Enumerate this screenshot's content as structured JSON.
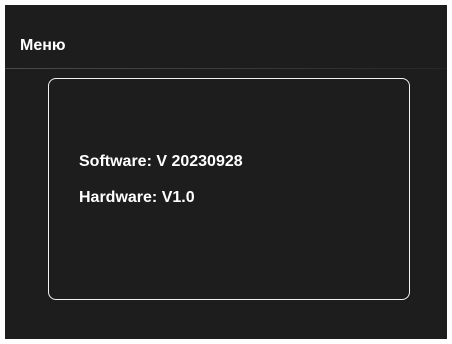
{
  "header": {
    "title": "Меню"
  },
  "info": {
    "software": "Software: V 20230928",
    "hardware": "Hardware: V1.0"
  },
  "colors": {
    "background": "#1d1d1d",
    "text": "#ffffff",
    "panel_border": "#f2f2f2"
  }
}
